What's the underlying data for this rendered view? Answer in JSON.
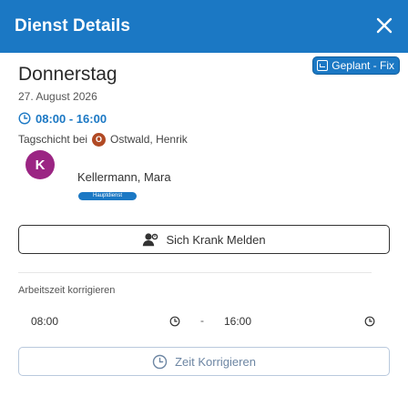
{
  "header": {
    "title": "Dienst Details",
    "close_icon": "close-icon"
  },
  "shift": {
    "day": "Donnerstag",
    "status": "Geplant - Fix",
    "date": "27. August 2026",
    "time": "08:00 - 16:00",
    "type_prefix": "Tagschicht bei",
    "supervisor_initial": "O",
    "supervisor_name": "Ostwald, Henrik"
  },
  "person": {
    "initial": "K",
    "name": "Kellermann, Mara",
    "role_badge": "Hauptdienst"
  },
  "actions": {
    "sick_label": "Sich Krank Melden",
    "correct_label": "Zeit Korrigieren"
  },
  "correction": {
    "section_label": "Arbeitszeit korrigieren",
    "start": "08:00",
    "separator": "-",
    "end": "16:00"
  },
  "colors": {
    "primary": "#1b78c4",
    "avatar": "#9b2583",
    "supervisor_avatar": "#b14a24"
  }
}
